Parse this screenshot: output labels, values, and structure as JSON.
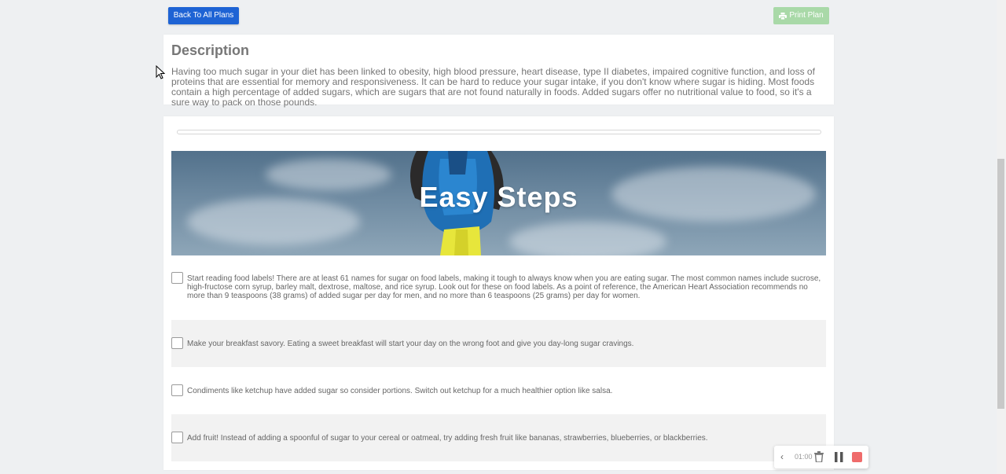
{
  "toolbar": {
    "back_label": "Back To All Plans",
    "print_label": "Print Plan",
    "print_icon": "printer-icon"
  },
  "description": {
    "title": "Description",
    "text": "Having too much sugar in your diet has been linked to obesity, high blood pressure, heart disease, type II diabetes, impaired cognitive function, and loss of proteins that are essential for memory and responsiveness. It can be hard to reduce your sugar intake, if you don't know where sugar is hiding. Most foods contain a high percentage of added sugars, which are sugars that are not found naturally in foods. Added sugars offer no nutritional value to food, so it's a sure way to pack on those pounds."
  },
  "plan": {
    "progress_fraction": 0,
    "banner_title": "Easy Steps",
    "steps": [
      {
        "text": "Start reading food labels! There are at least 61 names for sugar on food labels, making it tough to always know when you are eating sugar. The most common names include sucrose, high-fructose corn syrup, barley malt, dextrose, maltose, and rice syrup. Look out for these on food labels. As a point of reference, the American Heart Association recommends no more than 9 teaspoons (38 grams) of added sugar per day for men, and no more than 6 teaspoons (25 grams) per day for women.",
        "checked": false
      },
      {
        "text": "Make your breakfast savory. Eating a sweet breakfast will start your day on the wrong foot and give you day-long sugar cravings.",
        "checked": false
      },
      {
        "text": "Condiments like ketchup have added sugar so consider portions. Switch out ketchup for a much healthier option like salsa.",
        "checked": false
      },
      {
        "text": "Add fruit! Instead of adding a spoonful of sugar to your cereal or oatmeal, try adding fresh fruit like bananas, strawberries, blueberries, or blackberries.",
        "checked": false
      }
    ]
  },
  "recorder": {
    "time": "01:00",
    "back_icon": "chevron-left-icon",
    "trash_icon": "trash-icon",
    "pause_icon": "pause-icon",
    "stop_icon": "stop-icon"
  },
  "colors": {
    "primary": "#1e63d4",
    "print_button": "#a9d9a8",
    "stop": "#ef6b6b"
  }
}
